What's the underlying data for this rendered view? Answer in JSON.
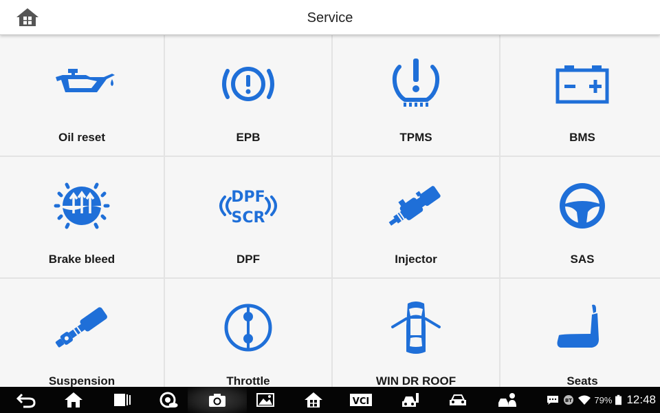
{
  "header": {
    "title": "Service",
    "home_icon": "home-icon"
  },
  "colors": {
    "accent": "#1f6fd8",
    "tile_bg": "#f6f6f6",
    "grid_line": "#e3e3e3",
    "navbar_bg": "#050505"
  },
  "tiles": [
    {
      "label": "Oil reset",
      "icon": "oil-can-icon"
    },
    {
      "label": "EPB",
      "icon": "parking-brake-icon"
    },
    {
      "label": "TPMS",
      "icon": "tire-pressure-icon"
    },
    {
      "label": "BMS",
      "icon": "battery-icon"
    },
    {
      "label": "Brake bleed",
      "icon": "brake-fluid-icon"
    },
    {
      "label": "DPF",
      "icon": "dpf-scr-icon"
    },
    {
      "label": "Injector",
      "icon": "injector-icon"
    },
    {
      "label": "SAS",
      "icon": "steering-wheel-icon"
    },
    {
      "label": "Suspension",
      "icon": "suspension-shock-icon"
    },
    {
      "label": "Throttle",
      "icon": "throttle-valve-icon"
    },
    {
      "label": "WIN DR ROOF",
      "icon": "car-doors-icon"
    },
    {
      "label": "Seats",
      "icon": "seat-icon"
    }
  ],
  "navbar": {
    "buttons": [
      "back-icon",
      "home-icon",
      "recent-apps-icon",
      "browser-icon",
      "camera-icon",
      "screenshot-icon",
      "launcher-home-icon",
      "vci-icon",
      "diagnostic-car-icon",
      "car-icon",
      "technician-icon"
    ],
    "vci_label": "VCI",
    "status": {
      "battery": "79%",
      "time": "12:48",
      "icons": [
        "chat-icon",
        "bluetooth-icon",
        "wifi-icon",
        "battery-icon"
      ],
      "bluetooth_label": "BT"
    }
  }
}
